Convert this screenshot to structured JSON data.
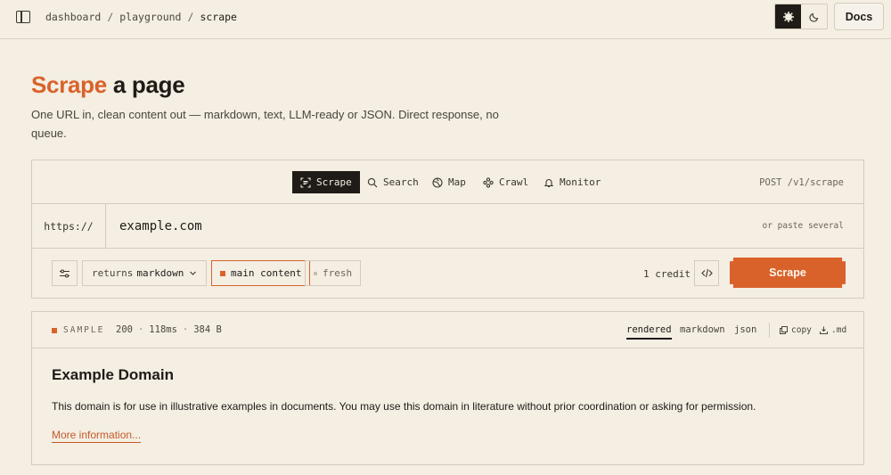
{
  "topbar": {
    "breadcrumb": [
      "dashboard",
      "playground",
      "scrape"
    ],
    "docs_label": "Docs"
  },
  "heading": {
    "title_accent": "Scrape",
    "title_rest": " a page",
    "subtitle": "One URL in, clean content out — markdown, text, LLM-ready or JSON. Direct response, no queue."
  },
  "tabs": [
    {
      "label": "Scrape",
      "icon": "scan-icon",
      "active": true
    },
    {
      "label": "Search",
      "icon": "search-icon",
      "active": false
    },
    {
      "label": "Map",
      "icon": "globe-icon",
      "active": false
    },
    {
      "label": "Crawl",
      "icon": "crawl-icon",
      "active": false
    },
    {
      "label": "Monitor",
      "icon": "bell-icon",
      "active": false
    }
  ],
  "endpoint": "POST /v1/scrape",
  "url": {
    "prefix": "https://",
    "value": "example.com",
    "hint": "or paste several"
  },
  "options": {
    "format_prefix": "returns",
    "format_value": "markdown",
    "main_content": "main content",
    "fresh": "fresh",
    "credit": "1 credit",
    "scrape_label": "Scrape"
  },
  "result": {
    "label": "SAMPLE",
    "status": "200",
    "time": "118ms",
    "size": "384 B",
    "views": [
      "rendered",
      "markdown",
      "json"
    ],
    "copy_label": "copy",
    "download_label": ".md",
    "title": "Example Domain",
    "body": "This domain is for use in illustrative examples in documents. You may use this domain in literature without prior coordination or asking for permission.",
    "link": "More information..."
  },
  "colors": {
    "accent": "#d9622b",
    "background": "#f4eee3",
    "ink": "#1f1b16"
  }
}
